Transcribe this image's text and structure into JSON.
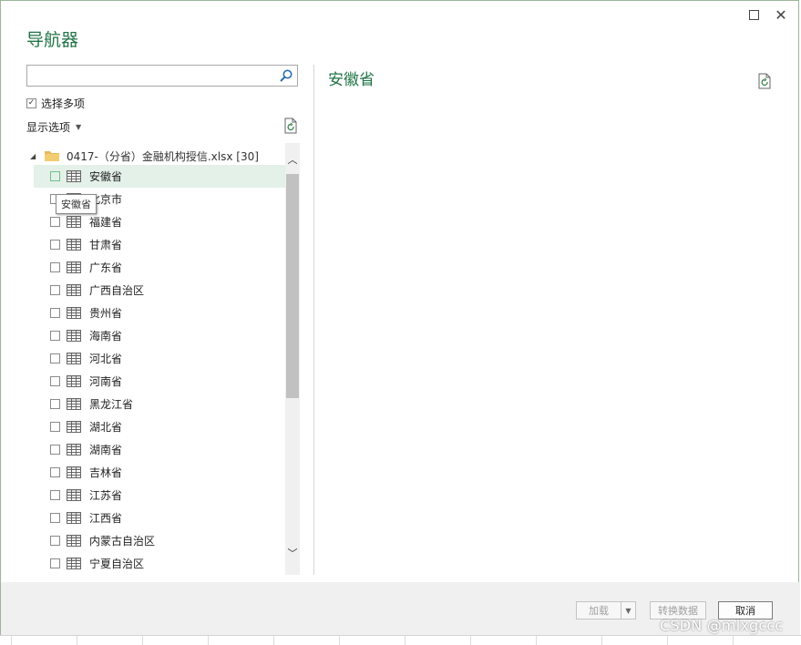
{
  "dialog": {
    "title": "导航器",
    "window_buttons": {
      "maximize_icon": "maximize-icon",
      "close_icon": "close-icon",
      "close_glyph": "✕"
    }
  },
  "left_pane": {
    "search": {
      "value": "",
      "placeholder": "",
      "icon": "search-icon"
    },
    "select_multiple": {
      "label": "选择多项",
      "checked": true,
      "check_glyph": "✓"
    },
    "display_options": {
      "label": "显示选项",
      "caret": "▼"
    },
    "refresh_icon": "refresh-icon",
    "tree": {
      "root": {
        "expander": "◢",
        "label": "0417-（分省）金融机构授信.xlsx [30]",
        "icon": "folder-icon"
      },
      "selected_index": 0,
      "items": [
        {
          "label": "安徽省"
        },
        {
          "label": "北京市"
        },
        {
          "label": "福建省"
        },
        {
          "label": "甘肃省"
        },
        {
          "label": "广东省"
        },
        {
          "label": "广西自治区"
        },
        {
          "label": "贵州省"
        },
        {
          "label": "海南省"
        },
        {
          "label": "河北省"
        },
        {
          "label": "河南省"
        },
        {
          "label": "黑龙江省"
        },
        {
          "label": "湖北省"
        },
        {
          "label": "湖南省"
        },
        {
          "label": "吉林省"
        },
        {
          "label": "江苏省"
        },
        {
          "label": "江西省"
        },
        {
          "label": "内蒙古自治区"
        },
        {
          "label": "宁夏自治区"
        }
      ],
      "tooltip": "安徽省"
    },
    "scrollbar": {
      "up": "︿",
      "down": "﹀"
    }
  },
  "preview": {
    "title": "安徽省",
    "refresh_icon": "refresh-icon"
  },
  "footer": {
    "load_label": "加载",
    "load_dropdown": "▼",
    "transform_label": "转换数据",
    "cancel_label": "取消"
  },
  "watermark": "CSDN @mlxgccc",
  "colors": {
    "accent": "#217346",
    "selected_row": "#e3f1e8",
    "footer_bg": "#f0f0f0"
  }
}
